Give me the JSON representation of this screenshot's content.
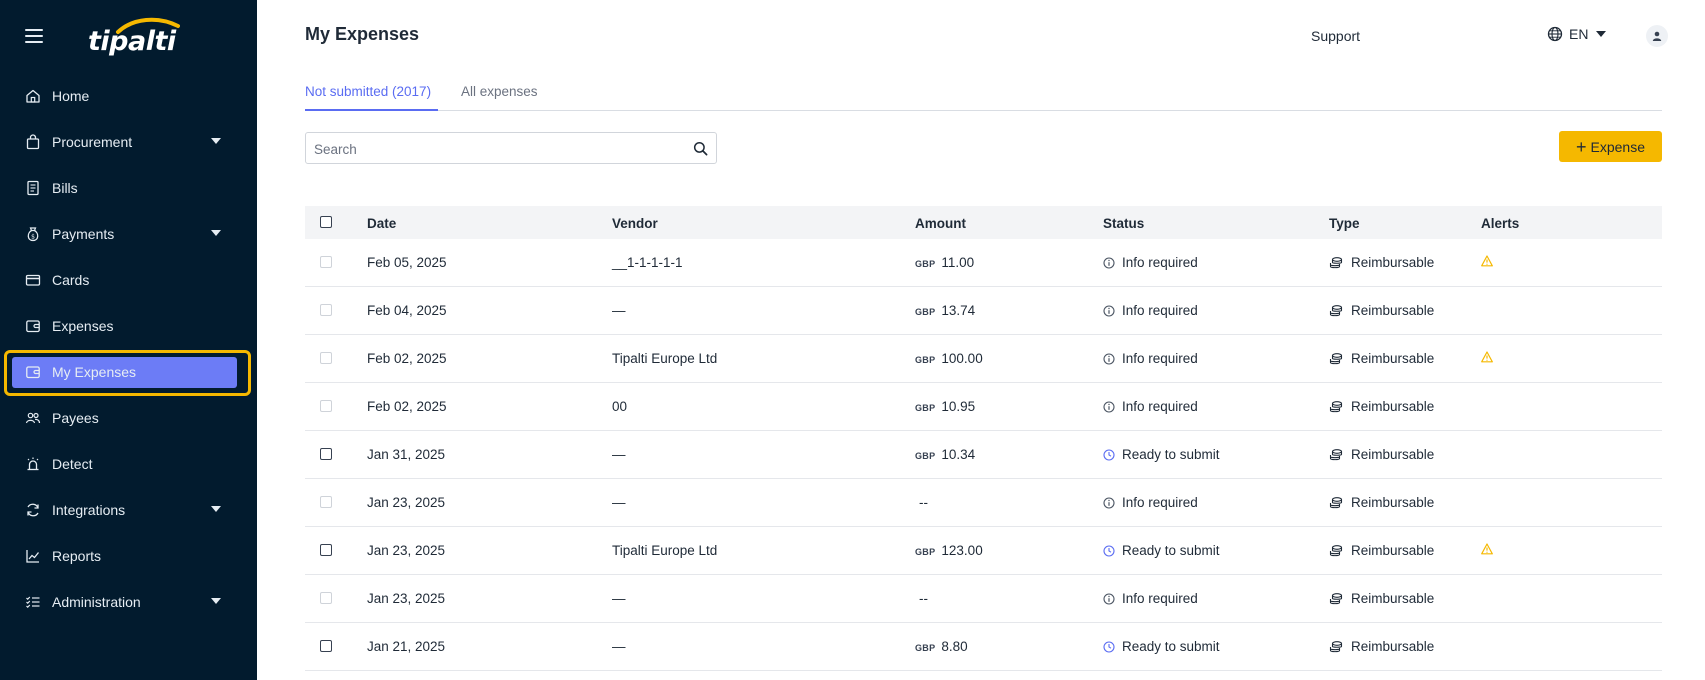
{
  "app": {
    "logo_text": "tipalti"
  },
  "sidebar": {
    "items": [
      {
        "label": "Home",
        "icon": "home-icon",
        "has_caret": false,
        "active": false
      },
      {
        "label": "Procurement",
        "icon": "bag-icon",
        "has_caret": true,
        "active": false
      },
      {
        "label": "Bills",
        "icon": "bill-icon",
        "has_caret": false,
        "active": false
      },
      {
        "label": "Payments",
        "icon": "money-bag-icon",
        "has_caret": true,
        "active": false
      },
      {
        "label": "Cards",
        "icon": "card-icon",
        "has_caret": false,
        "active": false
      },
      {
        "label": "Expenses",
        "icon": "wallet-icon",
        "has_caret": false,
        "active": false
      },
      {
        "label": "My Expenses",
        "icon": "wallet-icon",
        "has_caret": false,
        "active": true
      },
      {
        "label": "Payees",
        "icon": "people-icon",
        "has_caret": false,
        "active": false
      },
      {
        "label": "Detect",
        "icon": "alarm-icon",
        "has_caret": false,
        "active": false
      },
      {
        "label": "Integrations",
        "icon": "sync-icon",
        "has_caret": true,
        "active": false
      },
      {
        "label": "Reports",
        "icon": "chart-line-icon",
        "has_caret": false,
        "active": false
      },
      {
        "label": "Administration",
        "icon": "checklist-icon",
        "has_caret": true,
        "active": false
      }
    ]
  },
  "header": {
    "title": "My Expenses",
    "support_label": "Support",
    "language": "EN"
  },
  "tabs": [
    {
      "label": "Not submitted (2017)",
      "active": true
    },
    {
      "label": "All expenses",
      "active": false
    }
  ],
  "search": {
    "placeholder": "Search",
    "value": ""
  },
  "add_button": {
    "label": "Expense"
  },
  "table": {
    "columns": [
      "Date",
      "Vendor",
      "Amount",
      "Status",
      "Type",
      "Alerts"
    ],
    "rows": [
      {
        "date": "Feb 05, 2025",
        "vendor": "__1-1-1-1-1",
        "currency": "GBP",
        "amount": "11.00",
        "status": "Info required",
        "type": "Reimbursable",
        "alert": true,
        "selectable": false
      },
      {
        "date": "Feb 04, 2025",
        "vendor": "—",
        "currency": "GBP",
        "amount": "13.74",
        "status": "Info required",
        "type": "Reimbursable",
        "alert": false,
        "selectable": false
      },
      {
        "date": "Feb 02, 2025",
        "vendor": "Tipalti Europe Ltd",
        "currency": "GBP",
        "amount": "100.00",
        "status": "Info required",
        "type": "Reimbursable",
        "alert": true,
        "selectable": false
      },
      {
        "date": "Feb 02, 2025",
        "vendor": "00",
        "currency": "GBP",
        "amount": "10.95",
        "status": "Info required",
        "type": "Reimbursable",
        "alert": false,
        "selectable": false
      },
      {
        "date": "Jan 31, 2025",
        "vendor": "—",
        "currency": "GBP",
        "amount": "10.34",
        "status": "Ready to submit",
        "type": "Reimbursable",
        "alert": false,
        "selectable": true
      },
      {
        "date": "Jan 23, 2025",
        "vendor": "—",
        "currency": "",
        "amount": "--",
        "status": "Info required",
        "type": "Reimbursable",
        "alert": false,
        "selectable": false
      },
      {
        "date": "Jan 23, 2025",
        "vendor": "Tipalti Europe Ltd",
        "currency": "GBP",
        "amount": "123.00",
        "status": "Ready to submit",
        "type": "Reimbursable",
        "alert": true,
        "selectable": true
      },
      {
        "date": "Jan 23, 2025",
        "vendor": "—",
        "currency": "",
        "amount": "--",
        "status": "Info required",
        "type": "Reimbursable",
        "alert": false,
        "selectable": false
      },
      {
        "date": "Jan 21, 2025",
        "vendor": "—",
        "currency": "GBP",
        "amount": "8.80",
        "status": "Ready to submit",
        "type": "Reimbursable",
        "alert": false,
        "selectable": true
      }
    ]
  },
  "colors": {
    "sidebar_bg": "#021b2e",
    "active_item": "#6c7cf6",
    "highlight_ring": "#f5b800",
    "accent": "#5a6cf2",
    "primary_button": "#f5b800",
    "alert": "#f5b800",
    "ready_status": "#5a6cf2",
    "info_status": "#4b5563"
  }
}
